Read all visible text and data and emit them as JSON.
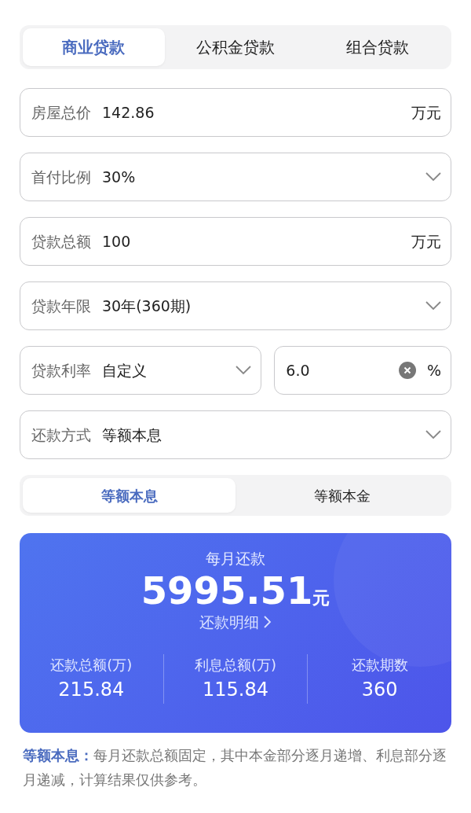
{
  "loan_tabs": [
    {
      "label": "商业贷款",
      "selected": true
    },
    {
      "label": "公积金贷款",
      "selected": false
    },
    {
      "label": "组合贷款",
      "selected": false
    }
  ],
  "fields": [
    {
      "kind": "input",
      "label": "房屋总价",
      "value": "142.86",
      "unit": "万元"
    },
    {
      "kind": "select",
      "label": "首付比例",
      "value": "30%"
    },
    {
      "kind": "input",
      "label": "贷款总额",
      "value": "100",
      "unit": "万元"
    },
    {
      "kind": "select",
      "label": "贷款年限",
      "value": "30年(360期)"
    },
    {
      "kind": "rate",
      "label": "贷款利率",
      "value": "自定义",
      "rate_value": "6.0",
      "unit": "%"
    },
    {
      "kind": "select",
      "label": "还款方式",
      "value": "等额本息"
    }
  ],
  "method_tabs": [
    {
      "label": "等额本息",
      "selected": true
    },
    {
      "label": "等额本金",
      "selected": false
    }
  ],
  "result": {
    "title": "每月还款",
    "amount": "5995.51",
    "currency": "元",
    "detail_link": "还款明细",
    "stats": [
      {
        "label": "还款总额(万)",
        "value": "215.84"
      },
      {
        "label": "利息总额(万)",
        "value": "115.84"
      },
      {
        "label": "还款期数",
        "value": "360"
      }
    ]
  },
  "note": "**等额本息：**每月还款总额固定，其中本金部分逐月递增、利息部分逐月递减，计算结果仅供参考。"
}
